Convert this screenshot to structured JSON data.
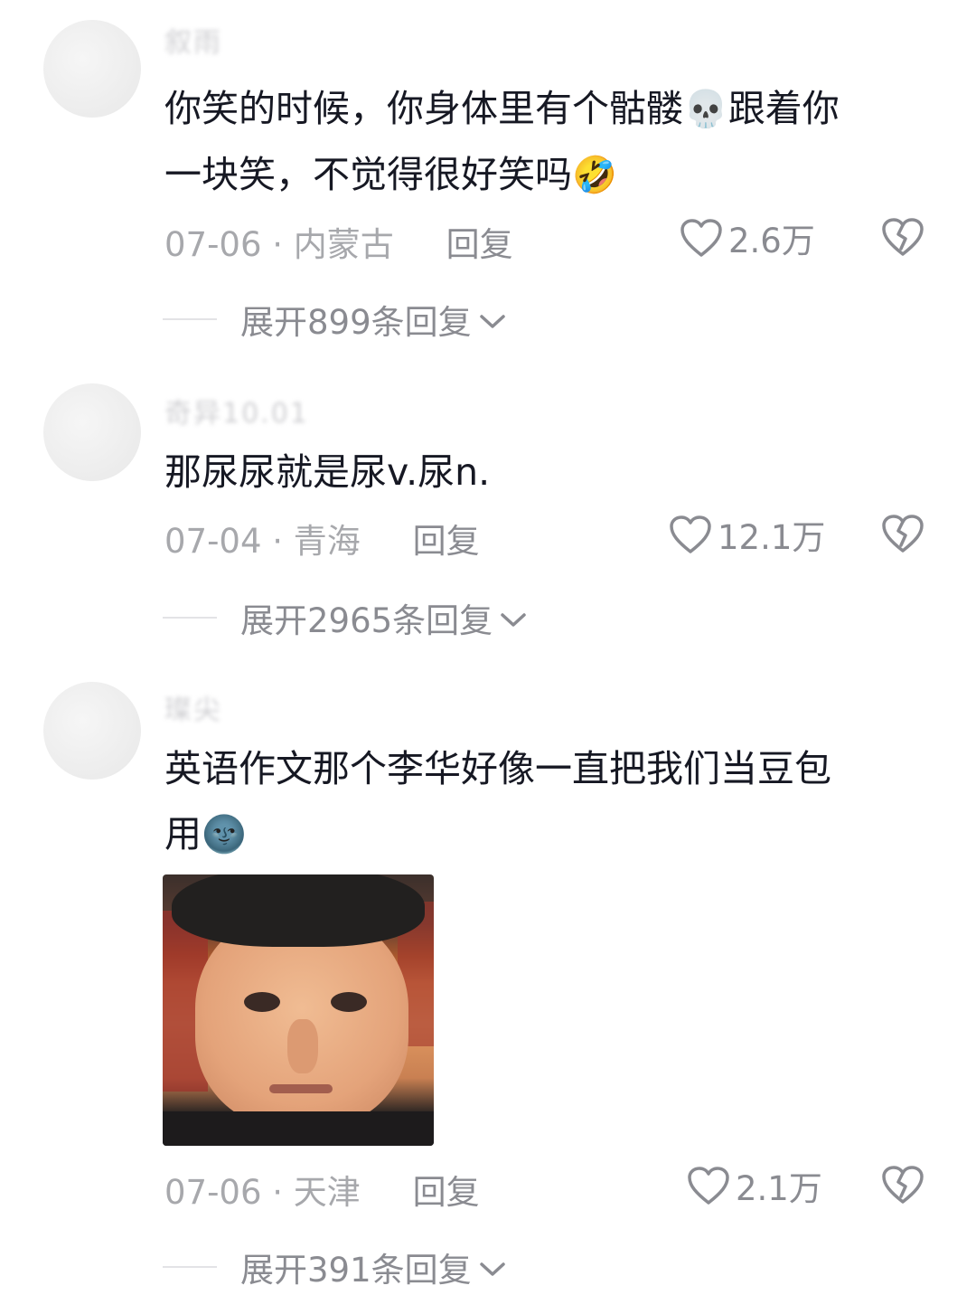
{
  "comments": [
    {
      "username": "叙雨",
      "text_line1": "你笑的时候，你身体里有个骷髅",
      "emoji_a": "💀",
      "text_line1b": "跟着你",
      "text_line2": "一块笑，不觉得很好笑吗",
      "emoji_b": "🤣",
      "date": "07-06",
      "location": "· 内蒙古",
      "reply_label": "回复",
      "likes": "2.6万",
      "expand_label": "展开899条回复"
    },
    {
      "username": "奇异10.01",
      "text": "那尿尿就是尿v.尿n.",
      "date": "07-04",
      "location": "· 青海",
      "reply_label": "回复",
      "likes": "12.1万",
      "expand_label": "展开2965条回复"
    },
    {
      "username": "璨尖",
      "text_line1": "英语作文那个李华好像一直把我们当豆包",
      "text_line2": "用",
      "emoji_a": "🌚",
      "date": "07-06",
      "location": "· 天津",
      "reply_label": "回复",
      "likes": "2.1万",
      "expand_label": "展开391条回复"
    }
  ],
  "icons": {
    "like": "heart-outline-icon",
    "dislike": "broken-heart-icon",
    "expand": "chevron-down-icon"
  },
  "colors": {
    "text": "#161823",
    "meta": "#a7a8ac",
    "action": "#8a8b91"
  }
}
